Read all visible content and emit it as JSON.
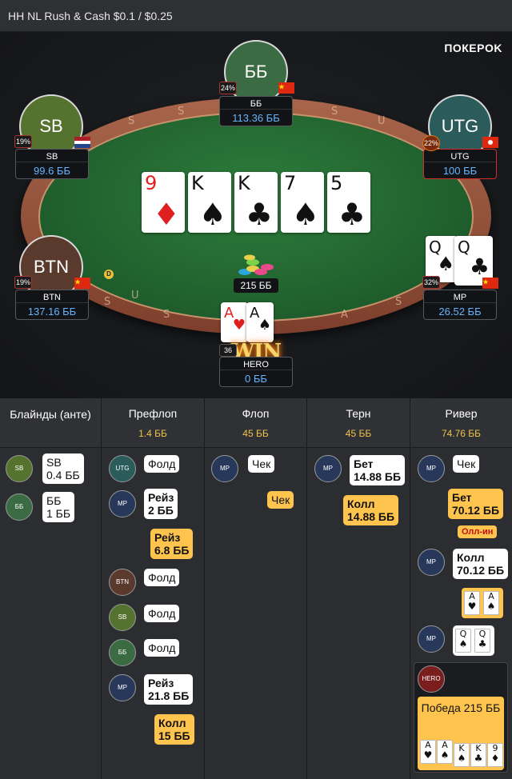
{
  "header": {
    "title": "HH NL Rush & Cash $0.1 / $0.25"
  },
  "brand": "ПОКЕРOK",
  "rail_chars": [
    "S",
    "S",
    "S",
    "S",
    "U",
    "S",
    "S",
    "U",
    "S",
    "A",
    "S"
  ],
  "seats": {
    "bb": {
      "avatar": "ББ",
      "name": "ББ",
      "stack": "113.36 ББ",
      "pct": "24%",
      "color": "#3b6b43"
    },
    "sb": {
      "avatar": "SB",
      "name": "SB",
      "stack": "99.6 ББ",
      "pct": "19%",
      "color": "#56722f"
    },
    "utg": {
      "avatar": "UTG",
      "name": "UTG",
      "stack": "100 ББ",
      "pct": "22%",
      "color": "#2c5b5c"
    },
    "btn": {
      "avatar": "BTN",
      "name": "BTN",
      "stack": "137.16 ББ",
      "pct": "19%",
      "color": "#5a3a2c"
    },
    "mp": {
      "name": "MP",
      "stack": "26.52 ББ",
      "pct": "32%",
      "cards": [
        {
          "rank": "Q",
          "suit": "♠"
        },
        {
          "rank": "Q",
          "suit": "♣"
        }
      ]
    },
    "hero": {
      "name": "HERO",
      "stack": "0 ББ",
      "pct": "36",
      "cards": [
        {
          "rank": "A",
          "suit": "♥"
        },
        {
          "rank": "A",
          "suit": "♠"
        }
      ]
    }
  },
  "board": [
    {
      "rank": "9",
      "suit": "♦",
      "color": "red"
    },
    {
      "rank": "K",
      "suit": "♠",
      "color": "blk"
    },
    {
      "rank": "K",
      "suit": "♣",
      "color": "blk"
    },
    {
      "rank": "7",
      "suit": "♠",
      "color": "blk"
    },
    {
      "rank": "5",
      "suit": "♣",
      "color": "blk"
    }
  ],
  "pot": "215 ББ",
  "dealer": "D",
  "win_label": "WIN",
  "history": {
    "blinds": {
      "title": "Блайнды (анте)",
      "actions": [
        {
          "pos": "SB",
          "line1": "SB",
          "line2": "0.4 ББ"
        },
        {
          "pos": "ББ",
          "line1": "ББ",
          "line2": "1 ББ"
        }
      ]
    },
    "preflop": {
      "title": "Префлоп",
      "pot": "1.4 ББ",
      "actions": [
        {
          "pos": "UTG",
          "text": "Фолд"
        },
        {
          "pos": "MP",
          "line1": "Рейз",
          "line2": "2 ББ"
        },
        {
          "line1": "Рейз",
          "line2": "6.8 ББ"
        },
        {
          "pos": "BTN",
          "text": "Фолд"
        },
        {
          "pos": "SB",
          "text": "Фолд"
        },
        {
          "pos": "ББ",
          "text": "Фолд"
        },
        {
          "pos": "MP",
          "line1": "Рейз",
          "line2": "21.8 ББ"
        },
        {
          "line1": "Колл",
          "line2": "15 ББ"
        }
      ]
    },
    "flop": {
      "title": "Флоп",
      "pot": "45 ББ",
      "actions": [
        {
          "pos": "MP",
          "text": "Чек"
        },
        {
          "text": "Чек"
        }
      ]
    },
    "turn": {
      "title": "Терн",
      "pot": "45 ББ",
      "actions": [
        {
          "pos": "MP",
          "line1": "Бет",
          "line2": "14.88 ББ"
        },
        {
          "line1": "Колл",
          "line2": "14.88 ББ"
        }
      ]
    },
    "river": {
      "title": "Ривер",
      "pot": "74.76 ББ",
      "actions": [
        {
          "pos": "MP",
          "text": "Чек"
        },
        {
          "line1": "Бет",
          "line2": "70.12 ББ",
          "badge": "Олл-ин"
        },
        {
          "pos": "MP",
          "line1": "Колл",
          "line2": "70.12 ББ"
        },
        {
          "cards": [
            {
              "rank": "A",
              "suit": "♥"
            },
            {
              "rank": "A",
              "suit": "♠"
            }
          ]
        },
        {
          "pos": "MP",
          "cards": [
            {
              "rank": "Q",
              "suit": "♠"
            },
            {
              "rank": "Q",
              "suit": "♣"
            }
          ]
        },
        {
          "pos": "HERO",
          "win_text": "Победа 215 ББ",
          "cards": [
            {
              "rank": "A",
              "suit": "♥"
            },
            {
              "rank": "A",
              "suit": "♠"
            },
            {
              "rank": "K",
              "suit": "♠"
            },
            {
              "rank": "K",
              "suit": "♣"
            },
            {
              "rank": "9",
              "suit": "♦"
            }
          ]
        }
      ]
    }
  }
}
